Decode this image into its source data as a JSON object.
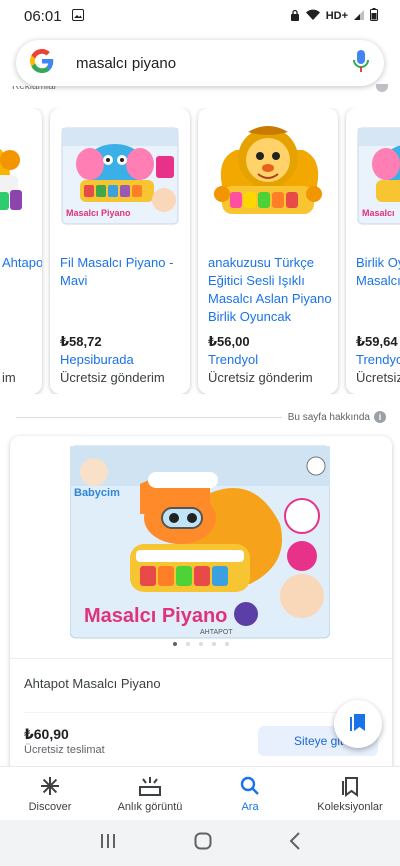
{
  "status_bar": {
    "time": "06:01",
    "network": "HD+"
  },
  "search": {
    "query": "masalcı piyano"
  },
  "results_label": "Reklamlar",
  "products": [
    {
      "title": "Ahtapot",
      "price": "",
      "store": "",
      "shipping": "im"
    },
    {
      "title": "Fil Masalcı Piyano - Mavi",
      "price": "₺58,72",
      "store": "Hepsiburada",
      "shipping": "Ücretsiz gönderim"
    },
    {
      "title": "anakuzusu Türkçe Eğitici Sesli Işıklı Masalcı Aslan Piyano Birlik Oyuncak",
      "price": "₺56,00",
      "store": "Trendyol",
      "shipping": "Ücretsiz gönderim"
    },
    {
      "title": "Birlik Oyuncak Masalcı Piyano",
      "price": "₺59,64",
      "store": "Trendyol",
      "shipping": "Ücretsiz gönderim"
    }
  ],
  "about_page": "Bu sayfa hakkında",
  "main_product": {
    "title": "Ahtapot Masalcı Piyano",
    "price": "₺60,90",
    "shipping": "Ücretsiz teslimat",
    "site_button": "Siteye git",
    "box_brand": "Babycim",
    "box_title": "Masalcı Piyano",
    "box_subtitle": "AHTAPOT",
    "image_count": 5,
    "active_image": 0
  },
  "bottom_nav": [
    {
      "label": "Discover",
      "icon": "asterisk-icon",
      "active": false
    },
    {
      "label": "Anlık görüntü",
      "icon": "snapshot-icon",
      "active": false
    },
    {
      "label": "Ara",
      "icon": "search-icon",
      "active": true
    },
    {
      "label": "Koleksiyonlar",
      "icon": "collections-icon",
      "active": false
    }
  ],
  "colors": {
    "accent": "#1a73e8",
    "price": "#202124",
    "button_bg": "#e8f0fe"
  }
}
